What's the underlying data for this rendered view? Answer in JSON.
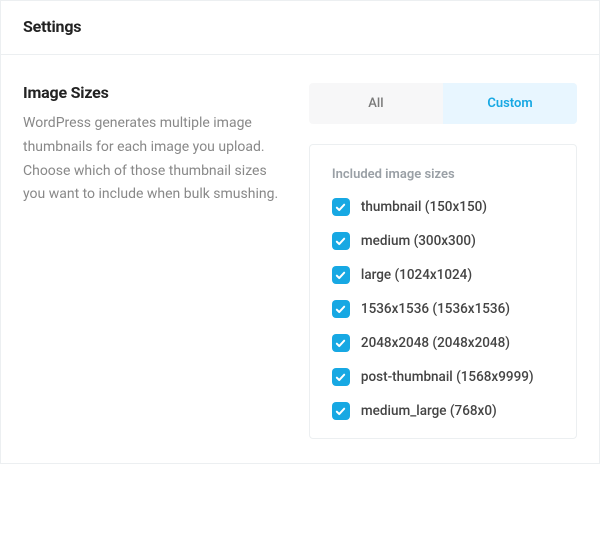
{
  "header": {
    "title": "Settings"
  },
  "section": {
    "title": "Image Sizes",
    "description": "WordPress generates multiple image thumbnails for each image you upload. Choose which of those thumbnail sizes you want to include when bulk smushing."
  },
  "tabs": {
    "all": "All",
    "custom": "Custom",
    "active": "custom"
  },
  "sizes": {
    "heading": "Included image sizes",
    "items": [
      {
        "label": "thumbnail (150x150)",
        "checked": true
      },
      {
        "label": "medium (300x300)",
        "checked": true
      },
      {
        "label": "large (1024x1024)",
        "checked": true
      },
      {
        "label": "1536x1536 (1536x1536)",
        "checked": true
      },
      {
        "label": "2048x2048 (2048x2048)",
        "checked": true
      },
      {
        "label": "post-thumbnail (1568x9999)",
        "checked": true
      },
      {
        "label": "medium_large (768x0)",
        "checked": true
      }
    ]
  }
}
